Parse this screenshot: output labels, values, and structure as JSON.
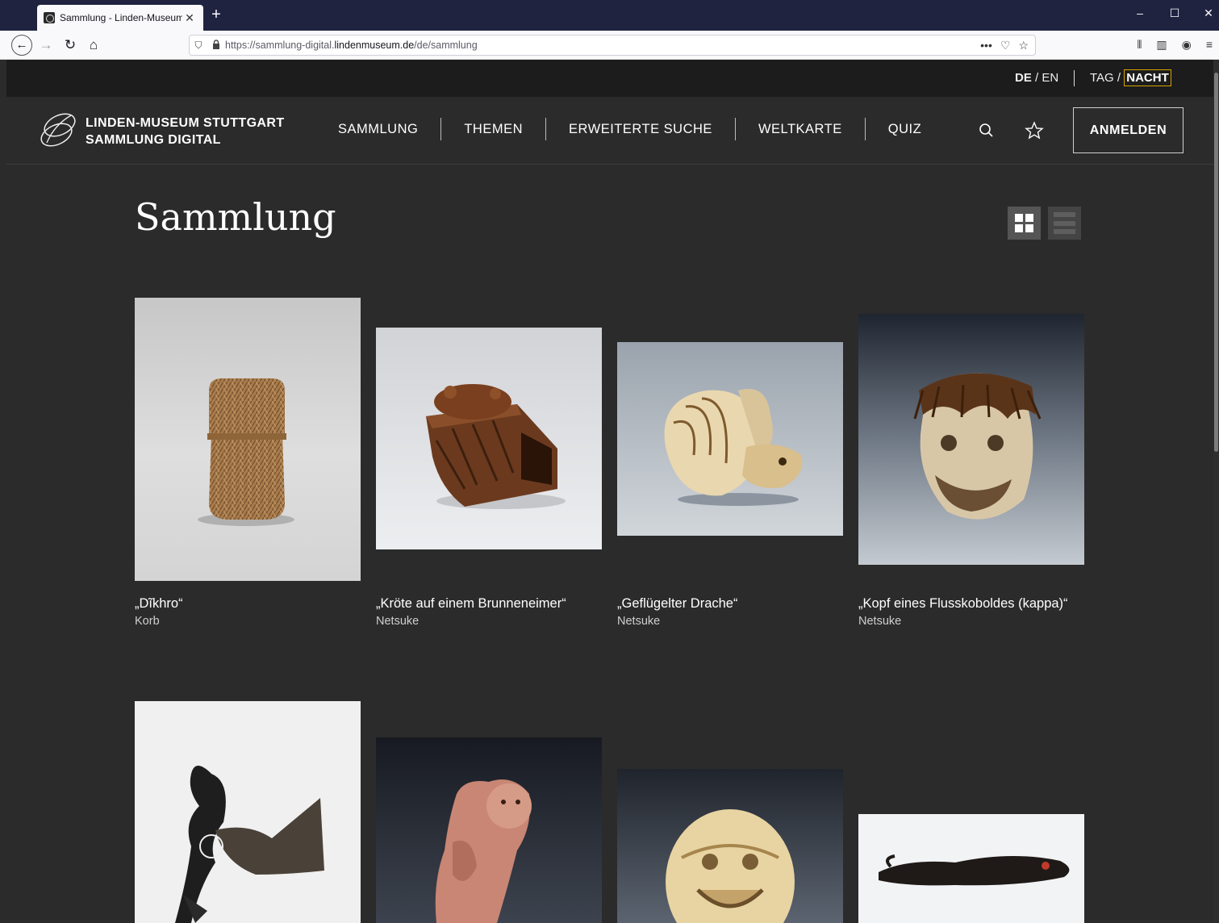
{
  "browser": {
    "tab_title": "Sammlung - Linden-Museum S",
    "tab_close": "✕",
    "new_tab": "+",
    "url_prefix": "https://sammlung-digital.",
    "url_host": "lindenmuseum.de",
    "url_path": "/de/sammlung",
    "window_controls": [
      "–",
      "☐",
      "✕"
    ],
    "more_icon": "•••"
  },
  "lang_switch": {
    "active": "DE",
    "separator": " / ",
    "other": "EN"
  },
  "mode_switch": {
    "day": "TAG",
    "separator": " / ",
    "night": "NACHT"
  },
  "logo": {
    "line1": "LINDEN-MUSEUM STUTTGART",
    "line2": "SAMMLUNG DIGITAL"
  },
  "nav": {
    "items": [
      "SAMMLUNG",
      "THEMEN",
      "ERWEITERTE SUCHE",
      "WELTKARTE",
      "QUIZ"
    ]
  },
  "login_label": "ANMELDEN",
  "page_title": "Sammlung",
  "view_mode": "grid",
  "objects": [
    {
      "title": "„Dĩkhro“",
      "type": "Korb",
      "image": "woven-basket"
    },
    {
      "title": "„Kröte auf einem Brunneneimer“",
      "type": "Netsuke",
      "image": "wooden-toad-netsuke"
    },
    {
      "title": "„Geflügelter Drache“",
      "type": "Netsuke",
      "image": "ivory-dragon-netsuke"
    },
    {
      "title": "„Kopf eines Flusskoboldes (kappa)“",
      "type": "Netsuke",
      "image": "kappa-head-netsuke"
    },
    {
      "title": "",
      "type": "",
      "image": "shadow-puppet"
    },
    {
      "title": "",
      "type": "",
      "image": "pink-figure-netsuke"
    },
    {
      "title": "",
      "type": "",
      "image": "lion-mask-netsuke"
    },
    {
      "title": "",
      "type": "",
      "image": "dark-dragon-object"
    }
  ],
  "colors": {
    "page_bg": "#2b2b2b",
    "topbar_bg": "#1c1c1c",
    "browser_tabbar": "#202340",
    "accent_outline": "#d4a300"
  }
}
